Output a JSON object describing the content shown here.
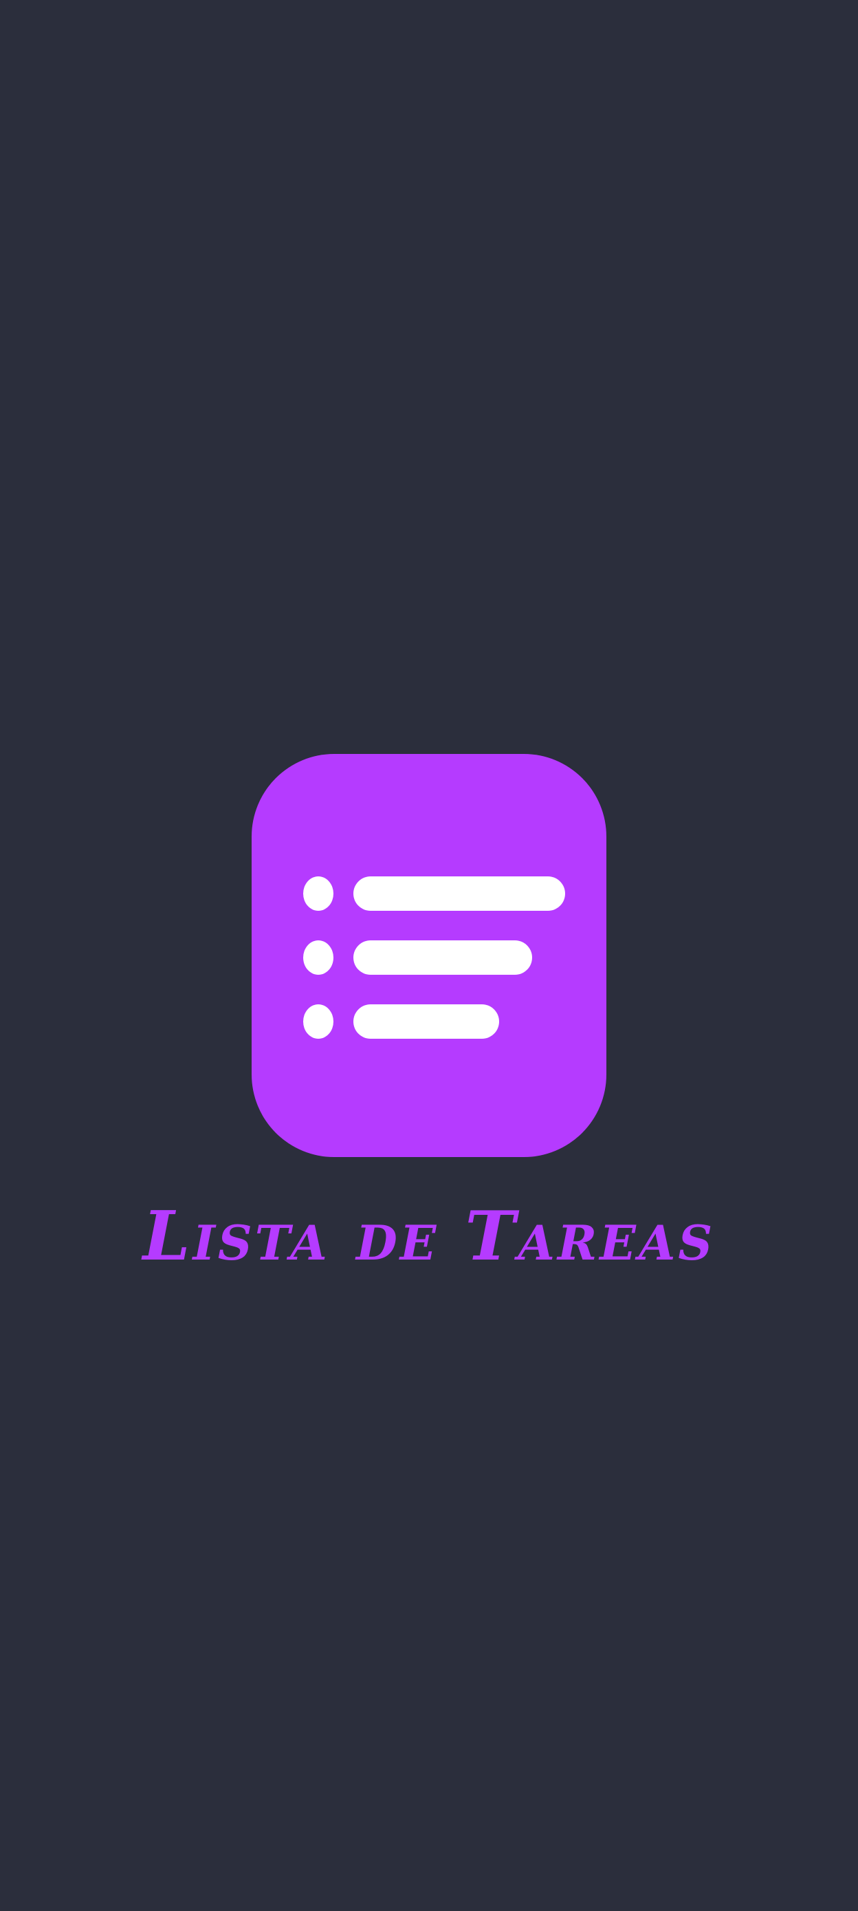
{
  "app": {
    "title": "Lista de Tareas",
    "icon": "task-list-icon"
  },
  "colors": {
    "background": "#2b2e3c",
    "accent": "#b53bff",
    "icon_glyph": "#ffffff"
  }
}
